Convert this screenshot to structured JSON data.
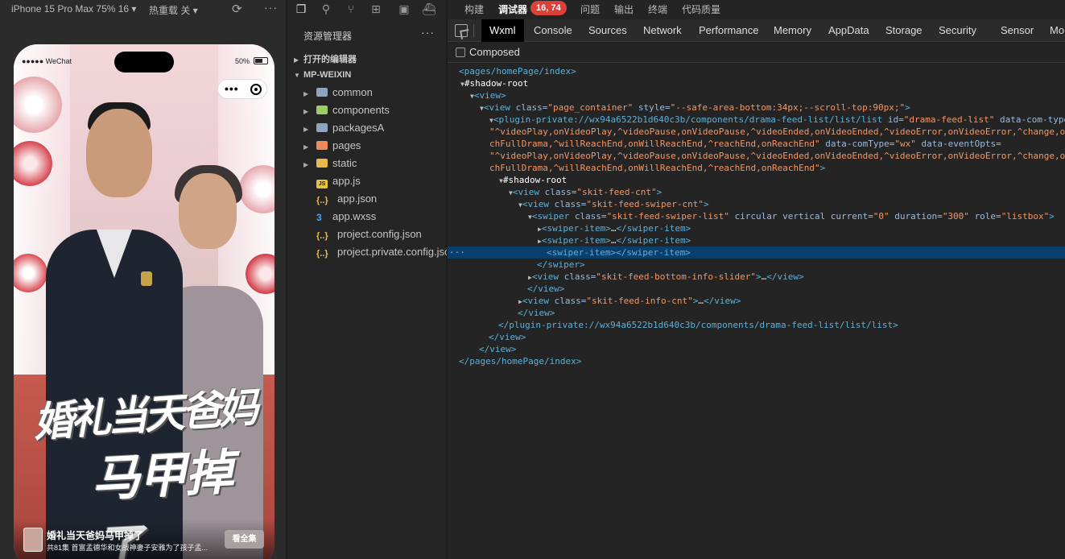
{
  "simulator": {
    "device_label": "iPhone 15 Pro Max 75% 16 ▾",
    "reload_label": "热重载 关 ▾",
    "phone": {
      "carrier": "●●●●● WeChat",
      "battery_pct": "50%",
      "poster_title_line1": "婚礼当天爸妈",
      "poster_title_line2": "马甲掉了",
      "info_title": "婚礼当天爸妈马甲掉了",
      "info_subtitle": "共81集 首富孟德华和女战神妻子安雅为了孩子孟...",
      "watch_button": "看全集"
    }
  },
  "explorer": {
    "title": "资源管理器",
    "open_editors": "打开的编辑器",
    "project": "MP-WEIXIN",
    "items": [
      {
        "label": "common",
        "type": "folder",
        "icon": "folder-icon"
      },
      {
        "label": "components",
        "type": "folder",
        "icon": "components-folder-icon"
      },
      {
        "label": "packagesA",
        "type": "folder",
        "icon": "folder-icon"
      },
      {
        "label": "pages",
        "type": "folder",
        "icon": "pages-folder-icon"
      },
      {
        "label": "static",
        "type": "folder",
        "icon": "static-folder-icon"
      },
      {
        "label": "app.js",
        "type": "file",
        "icon": "js-file-icon"
      },
      {
        "label": "app.json",
        "type": "file",
        "icon": "json-file-icon"
      },
      {
        "label": "app.wxss",
        "type": "file",
        "icon": "wxss-file-icon"
      },
      {
        "label": "project.config.json",
        "type": "file",
        "icon": "json-file-icon"
      },
      {
        "label": "project.private.config.json",
        "type": "file",
        "icon": "json-file-icon"
      }
    ]
  },
  "devtools": {
    "top_tabs": [
      "构建",
      "调试器",
      "问题",
      "输出",
      "终端",
      "代码质量"
    ],
    "active_top_tab": "调试器",
    "error_count": "16, 74",
    "tabs": [
      "Wxml",
      "Console",
      "Sources",
      "Network",
      "Performance",
      "Memory",
      "AppData",
      "Storage",
      "Security",
      "Sensor",
      "Mo"
    ],
    "active_tab": "Wxml",
    "composed_label": "Composed",
    "colors": {
      "accent_selected": "#0b3f6b",
      "badge": "#d9413a",
      "tag": "#5db0d7",
      "attr_value": "#f29766"
    }
  }
}
